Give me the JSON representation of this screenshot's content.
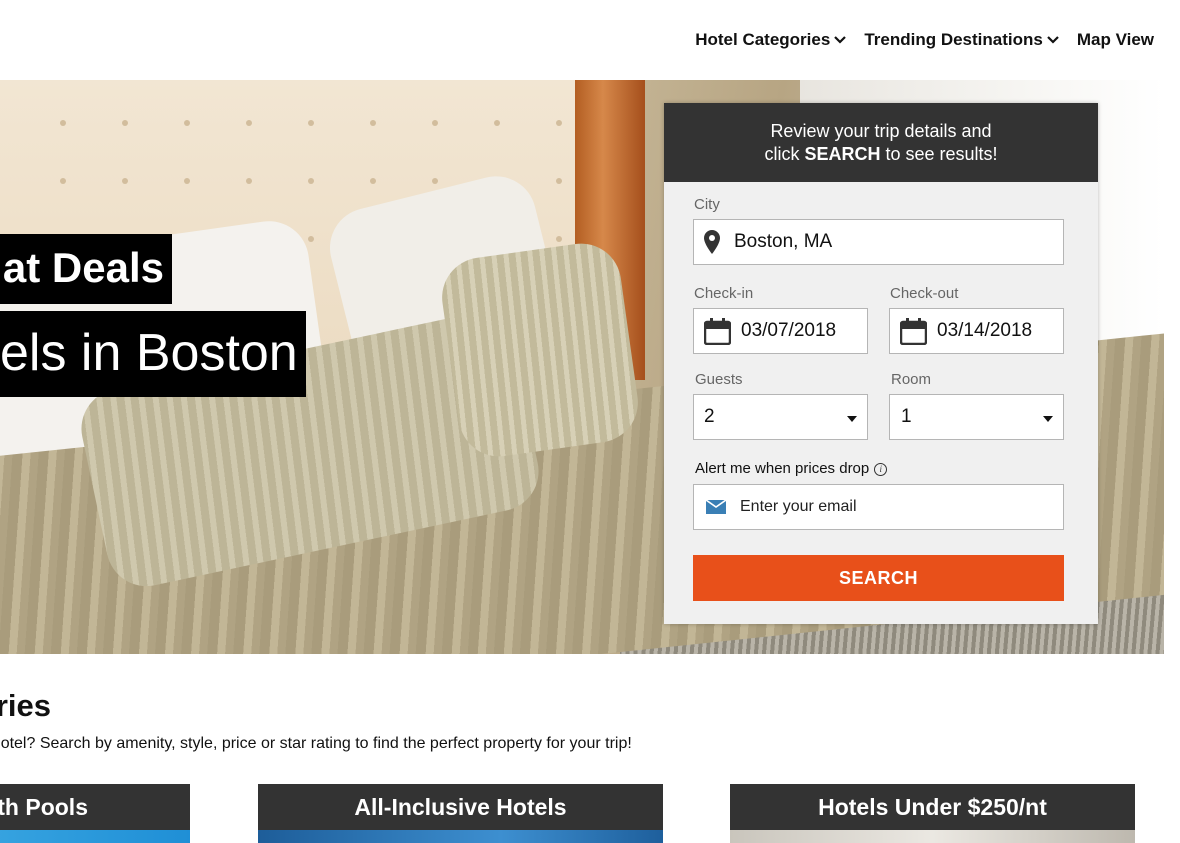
{
  "nav": {
    "items": [
      {
        "label": "Hotel Categories",
        "has_dropdown": true
      },
      {
        "label": "Trending Destinations",
        "has_dropdown": true
      },
      {
        "label": "Map View",
        "has_dropdown": false
      }
    ]
  },
  "hero": {
    "headline_line1": "at Deals",
    "headline_line2": "els in Boston"
  },
  "search_panel": {
    "header_line1": "Review your trip details and",
    "header_line2_prefix": "click ",
    "header_line2_bold": "SEARCH",
    "header_line2_suffix": " to see results!",
    "city_label": "City",
    "city_value": "Boston, MA",
    "checkin_label": "Check-in",
    "checkin_value": "03/07/2018",
    "checkout_label": "Check-out",
    "checkout_value": "03/14/2018",
    "guests_label": "Guests",
    "guests_value": "2",
    "room_label": "Room",
    "room_value": "1",
    "alert_label": "Alert me when prices drop",
    "email_placeholder": "Enter your email",
    "search_button": "SEARCH",
    "button_color": "#e8501a"
  },
  "categories": {
    "title": "gories",
    "subtitle": "of hotel? Search by amenity, style, price or star rating to find the perfect property for your trip!",
    "cards": [
      {
        "title": "th Pools",
        "image_color": "#2aa0e0"
      },
      {
        "title": "All-Inclusive Hotels",
        "image_color": "#1f6fb0"
      },
      {
        "title": "Hotels Under $250/nt",
        "image_color": "#d8d4cc"
      }
    ]
  }
}
